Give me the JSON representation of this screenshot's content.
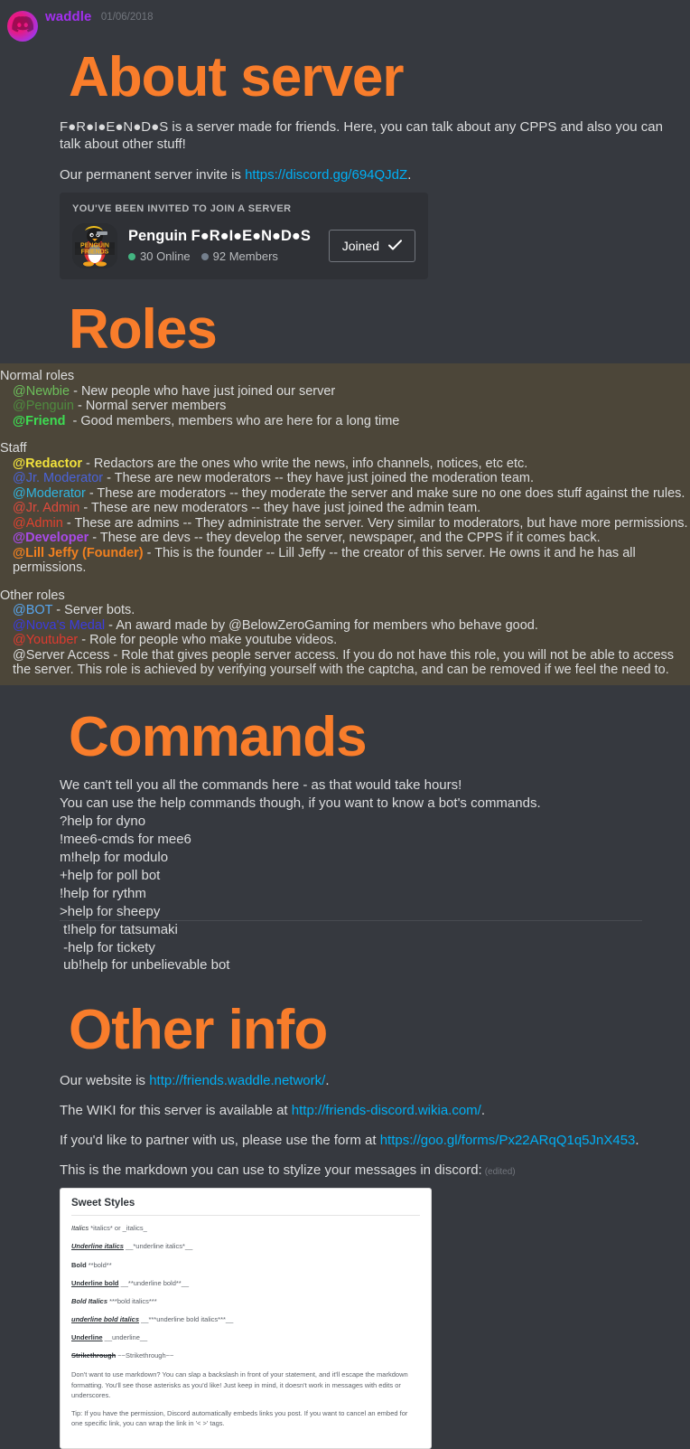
{
  "message": {
    "author": "waddle",
    "timestamp": "01/06/2018",
    "avatar_icon": "discord-logo-icon"
  },
  "sections": {
    "about": {
      "heading": "About server",
      "intro": "F●R●I●E●N●D●S is a server made for friends. Here, you can talk about any CPPS and also you can talk about other stuff!",
      "invite_prefix": "Our permanent server invite is ",
      "invite_link": "https://discord.gg/694QJdZ",
      "invite_suffix": "."
    },
    "invite_embed": {
      "title": "YOU'VE BEEN INVITED TO JOIN A SERVER",
      "server_name": "Penguin F●R●I●E●N●D●S",
      "online": "30 Online",
      "members": "92 Members",
      "button_label": "Joined",
      "button_icon": "check-icon",
      "icon_name": "penguin-friends-server-icon",
      "icon_text_1": "PENGUIN",
      "icon_text_2": "FRIENDS"
    },
    "roles": {
      "heading": "Roles",
      "groups": [
        {
          "title": "Normal roles",
          "items": [
            {
              "mention": "@Newbie",
              "color": "#6cbf5b",
              "bold": false,
              "desc": " - New people who have just joined our server"
            },
            {
              "mention": "@Penguin",
              "color": "#4f8c3f",
              "bold": false,
              "desc": " - Normal server members"
            },
            {
              "mention": "@Friend",
              "color": "#3ddc52",
              "bold": true,
              "desc": "  - Good members, members who are here for a long time"
            }
          ]
        },
        {
          "title": "Staff",
          "items": [
            {
              "mention": "@Redactor",
              "color": "#f2e23c",
              "bold": true,
              "desc": " - Redactors are the ones who write the news, info channels, notices, etc etc."
            },
            {
              "mention": "@Jr. Moderator",
              "color": "#4a63d8",
              "bold": false,
              "desc": " - These are new moderators -- they have just joined the moderation team."
            },
            {
              "mention": "@Moderator",
              "color": "#2fb5e0",
              "bold": false,
              "desc": " - These are moderators -- they moderate the server and make sure no one does stuff against the rules."
            },
            {
              "mention": "@Jr. Admin",
              "color": "#e04a3c",
              "bold": false,
              "desc": " - These are new moderators -- they have just joined the admin team."
            },
            {
              "mention": "@Admin",
              "color": "#e0422f",
              "bold": false,
              "desc": " - These are admins -- They administrate the server. Very similar to moderators, but have more permissions."
            },
            {
              "mention": "@Developer",
              "color": "#a84ae8",
              "bold": true,
              "desc": " - These are devs -- they develop the server, newspaper, and the CPPS if it comes back."
            },
            {
              "mention": "@Lill Jeffy (Founder)",
              "color": "#f08020",
              "bold": true,
              "desc": " - This is the founder -- Lill Jeffy -- the creator of this server. He owns it and he has all permissions."
            }
          ]
        },
        {
          "title": "Other roles",
          "items": [
            {
              "mention": "@BOT",
              "color": "#58a7ef",
              "bold": false,
              "desc": " - Server bots."
            },
            {
              "mention": "@Nova's Medal",
              "color": "#3b3ce0",
              "bold": false,
              "desc": " - An award made by @BelowZeroGaming for members who behave good."
            },
            {
              "mention": "@Youtuber",
              "color": "#e03a2f",
              "bold": false,
              "desc": " - Role for people who make youtube videos."
            },
            {
              "mention": "@Server Access",
              "color": "#dcddde",
              "bold": false,
              "desc": " - Role that gives people server access. If you do not have this role, you will not be able to access the server. This role is achieved by verifying yourself with the captcha, and can be removed if we feel the need to."
            }
          ]
        }
      ]
    },
    "commands": {
      "heading": "Commands",
      "lines": [
        "We can't tell you all the commands here - as that would take hours!",
        "You can use the help commands though, if you want to know a bot's commands.",
        "?help for dyno",
        "!mee6-cmds for mee6",
        "m!help for modulo",
        "+help for poll bot",
        "!help for rythm",
        ">help for sheepy",
        " t!help for tatsumaki",
        " -help for tickety",
        " ub!help for unbelievable bot"
      ]
    },
    "other_info": {
      "heading": "Other info",
      "website_prefix": "Our website is ",
      "website_link": "http://friends.waddle.network/",
      "website_suffix": ".",
      "wiki_prefix": "The WIKI for this server is available at ",
      "wiki_link": "http://friends-discord.wikia.com/",
      "wiki_suffix": ".",
      "partner_prefix": "If you'd like to partner with us, please use the form at ",
      "partner_link": "https://goo.gl/forms/Px22ARqQ1q5JnX453",
      "partner_suffix": ".",
      "markdown_text": "This is the markdown you can use to stylize your messages in discord:",
      "edited_label": "(edited)"
    },
    "markdown_image": {
      "title": "Sweet Styles",
      "rows": [
        {
          "label": "Italics",
          "style": "it",
          "example": "*italics* or _italics_"
        },
        {
          "label": "Underline italics",
          "style": "bi ul",
          "example": "__*underline italics*__"
        },
        {
          "label": "Bold",
          "style": "b",
          "example": "**bold**"
        },
        {
          "label": "Underline bold",
          "style": "b ul",
          "example": "__**underline bold**__"
        },
        {
          "label": "Bold Italics",
          "style": "bi",
          "example": "***bold italics***"
        },
        {
          "label": "underline bold italics",
          "style": "bi ul",
          "example": "__***underline bold italics***__"
        },
        {
          "label": "Underline",
          "style": "b ul",
          "example": "__underline__"
        },
        {
          "label": "Strikethrough",
          "style": "b st",
          "example": "~~Strikethrough~~"
        }
      ],
      "note_1": "Don't want to use markdown? You can slap a backslash in front of your statement, and it'll escape the markdown formatting. You'll see those asterisks as you'd like! Just keep in mind, it doesn't work in messages with edits or underscores.",
      "note_2": "Tip: If you have the permission, Discord automatically embeds links you post. If you want to cancel an embed for one specific link, you can wrap the link in '< >' tags."
    }
  },
  "colors": {
    "background": "#36393f",
    "heading_orange": "#f97d2b",
    "link_blue": "#00aff4",
    "username_purple": "#a330ef",
    "blockquote_bg": "#4c4639",
    "blockquote_bar": "#f2a33c"
  }
}
